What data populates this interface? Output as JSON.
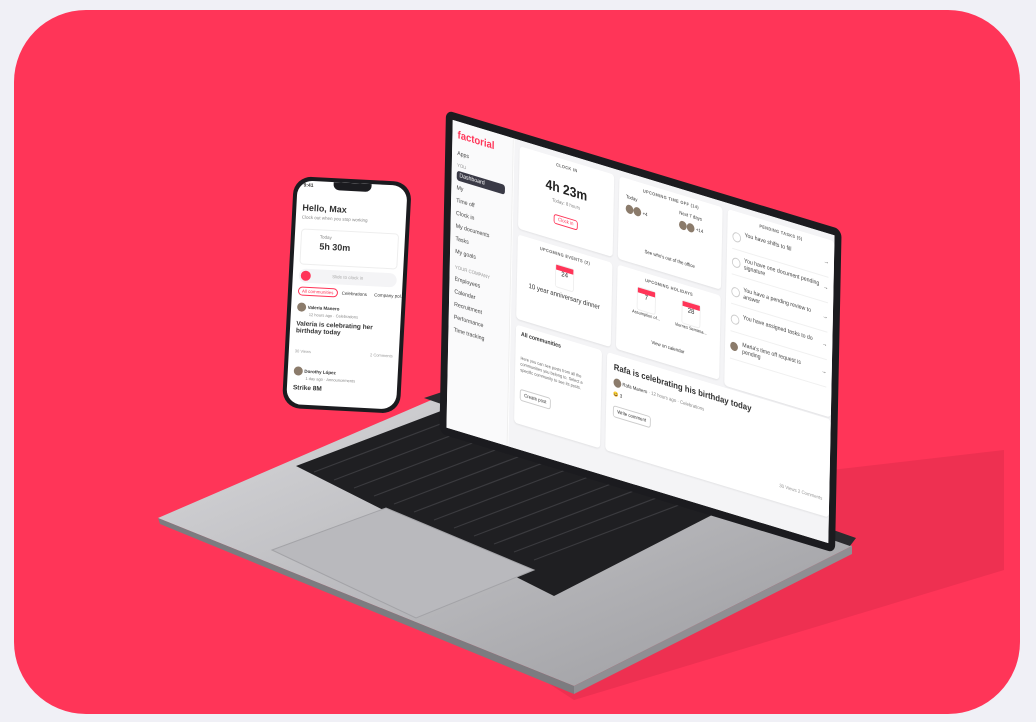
{
  "colors": {
    "accent": "#ff3558",
    "frame": "#f0f0f6"
  },
  "laptop": {
    "logo": "factorial",
    "nav": {
      "apps": "Apps",
      "you_header": "YOU",
      "items": [
        "Dashboard",
        "My",
        "Time off",
        "Clock in",
        "My documents",
        "Tasks",
        "My goals"
      ],
      "company_header": "YOUR COMPANY",
      "company_items": [
        "Employees",
        "Calendar",
        "Recruitment",
        "Performance",
        "Time tracking"
      ]
    },
    "clock_in": {
      "title": "CLOCK IN",
      "time": "4h 23m",
      "sub": "Today: 8 hours",
      "button": "Clock in"
    },
    "time_off": {
      "title": "UPCOMING TIME OFF (14)",
      "today": "Today",
      "next": "Next 7 days",
      "today_more": "+4",
      "next_more": "+14",
      "link": "See who's out of the office"
    },
    "tasks": {
      "title": "PENDING TASKS (5)",
      "items": [
        "You have shifts to fill",
        "You have one document pending signature",
        "You have a pending review to answer",
        "You have assigned tasks to do",
        "Maria's time off request is pending"
      ]
    },
    "events": {
      "title": "UPCOMING EVENTS (2)",
      "month": "JUL",
      "day": "24",
      "name": "10 year anniversary dinner"
    },
    "holidays": {
      "title": "UPCOMING HOLIDAYS",
      "d1": "7",
      "d1_label": "Assumption of...",
      "d2": "28",
      "d2_label": "Viernes Semana...",
      "link": "View on calendar"
    },
    "communities": {
      "title": "All communities",
      "text": "Here you can see posts from all the communities you belong to. Select a specific community to see its posts.",
      "button": "Create post"
    },
    "post": {
      "title": "Rafa is celebrating his birthday today",
      "author": "Rafa Manero",
      "meta": "· 12 hours ago · Celebrations",
      "reactions": "3",
      "button": "Write comment",
      "views": "30 Views",
      "comments": "2 Comments"
    }
  },
  "phone": {
    "time": "9:41",
    "greeting": "Hello, Max",
    "sub": "Clock out when you stop working",
    "today": "Today",
    "worked": "5h 30m",
    "slide": "Slide to clock in",
    "tabs": [
      "All communities",
      "Celebrations",
      "Company pol..."
    ],
    "post1_author": "Valeria Manero",
    "post1_meta": "12 hours ago · Celebrations",
    "post1_text": "Valeria is celebrating her birthday today",
    "views": "30 Views",
    "comments": "2 Comments",
    "post2_author": "Dorothy López",
    "post2_meta": "1 day ago · Announcements",
    "post2_text": "Strike 8M"
  }
}
